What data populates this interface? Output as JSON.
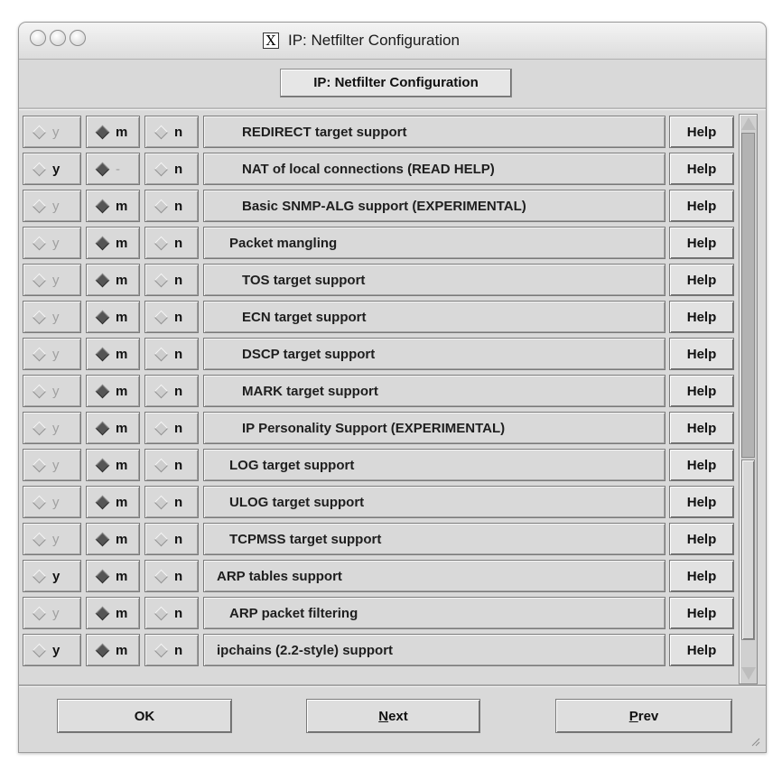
{
  "window": {
    "title": "IP: Netfilter Configuration",
    "x_icon": "X"
  },
  "header": {
    "button_label": "IP: Netfilter Configuration"
  },
  "rows": [
    {
      "y": {
        "label": "y",
        "enabled": false,
        "selected": false
      },
      "m": {
        "label": "m",
        "enabled": true,
        "selected": true
      },
      "n": {
        "label": "n",
        "enabled": true,
        "selected": false
      },
      "label": "REDIRECT target support",
      "indent": 3,
      "help": "Help"
    },
    {
      "y": {
        "label": "y",
        "enabled": true,
        "selected": false
      },
      "m": {
        "label": "-",
        "enabled": false,
        "selected": true
      },
      "n": {
        "label": "n",
        "enabled": true,
        "selected": false
      },
      "label": "NAT of local connections (READ HELP)",
      "indent": 3,
      "help": "Help"
    },
    {
      "y": {
        "label": "y",
        "enabled": false,
        "selected": false
      },
      "m": {
        "label": "m",
        "enabled": true,
        "selected": true
      },
      "n": {
        "label": "n",
        "enabled": true,
        "selected": false
      },
      "label": "Basic SNMP-ALG support (EXPERIMENTAL)",
      "indent": 3,
      "help": "Help"
    },
    {
      "y": {
        "label": "y",
        "enabled": false,
        "selected": false
      },
      "m": {
        "label": "m",
        "enabled": true,
        "selected": true
      },
      "n": {
        "label": "n",
        "enabled": true,
        "selected": false
      },
      "label": "Packet mangling",
      "indent": 2,
      "help": "Help"
    },
    {
      "y": {
        "label": "y",
        "enabled": false,
        "selected": false
      },
      "m": {
        "label": "m",
        "enabled": true,
        "selected": true
      },
      "n": {
        "label": "n",
        "enabled": true,
        "selected": false
      },
      "label": "TOS target support",
      "indent": 3,
      "help": "Help"
    },
    {
      "y": {
        "label": "y",
        "enabled": false,
        "selected": false
      },
      "m": {
        "label": "m",
        "enabled": true,
        "selected": true
      },
      "n": {
        "label": "n",
        "enabled": true,
        "selected": false
      },
      "label": "ECN target support",
      "indent": 3,
      "help": "Help"
    },
    {
      "y": {
        "label": "y",
        "enabled": false,
        "selected": false
      },
      "m": {
        "label": "m",
        "enabled": true,
        "selected": true
      },
      "n": {
        "label": "n",
        "enabled": true,
        "selected": false
      },
      "label": "DSCP target support",
      "indent": 3,
      "help": "Help"
    },
    {
      "y": {
        "label": "y",
        "enabled": false,
        "selected": false
      },
      "m": {
        "label": "m",
        "enabled": true,
        "selected": true
      },
      "n": {
        "label": "n",
        "enabled": true,
        "selected": false
      },
      "label": "MARK target support",
      "indent": 3,
      "help": "Help"
    },
    {
      "y": {
        "label": "y",
        "enabled": false,
        "selected": false
      },
      "m": {
        "label": "m",
        "enabled": true,
        "selected": true
      },
      "n": {
        "label": "n",
        "enabled": true,
        "selected": false
      },
      "label": "IP Personality Support (EXPERIMENTAL)",
      "indent": 3,
      "help": "Help"
    },
    {
      "y": {
        "label": "y",
        "enabled": false,
        "selected": false
      },
      "m": {
        "label": "m",
        "enabled": true,
        "selected": true
      },
      "n": {
        "label": "n",
        "enabled": true,
        "selected": false
      },
      "label": "LOG target support",
      "indent": 2,
      "help": "Help"
    },
    {
      "y": {
        "label": "y",
        "enabled": false,
        "selected": false
      },
      "m": {
        "label": "m",
        "enabled": true,
        "selected": true
      },
      "n": {
        "label": "n",
        "enabled": true,
        "selected": false
      },
      "label": "ULOG target support",
      "indent": 2,
      "help": "Help"
    },
    {
      "y": {
        "label": "y",
        "enabled": false,
        "selected": false
      },
      "m": {
        "label": "m",
        "enabled": true,
        "selected": true
      },
      "n": {
        "label": "n",
        "enabled": true,
        "selected": false
      },
      "label": "TCPMSS target support",
      "indent": 2,
      "help": "Help"
    },
    {
      "y": {
        "label": "y",
        "enabled": true,
        "selected": false
      },
      "m": {
        "label": "m",
        "enabled": true,
        "selected": true
      },
      "n": {
        "label": "n",
        "enabled": true,
        "selected": false
      },
      "label": "ARP tables support",
      "indent": 1,
      "help": "Help"
    },
    {
      "y": {
        "label": "y",
        "enabled": false,
        "selected": false
      },
      "m": {
        "label": "m",
        "enabled": true,
        "selected": true
      },
      "n": {
        "label": "n",
        "enabled": true,
        "selected": false
      },
      "label": "ARP packet filtering",
      "indent": 2,
      "help": "Help"
    },
    {
      "y": {
        "label": "y",
        "enabled": true,
        "selected": false
      },
      "m": {
        "label": "m",
        "enabled": true,
        "selected": true
      },
      "n": {
        "label": "n",
        "enabled": true,
        "selected": false
      },
      "label": "ipchains (2.2-style) support",
      "indent": 1,
      "help": "Help"
    }
  ],
  "buttons": {
    "ok": "OK",
    "next": "Next",
    "prev": "Prev"
  }
}
